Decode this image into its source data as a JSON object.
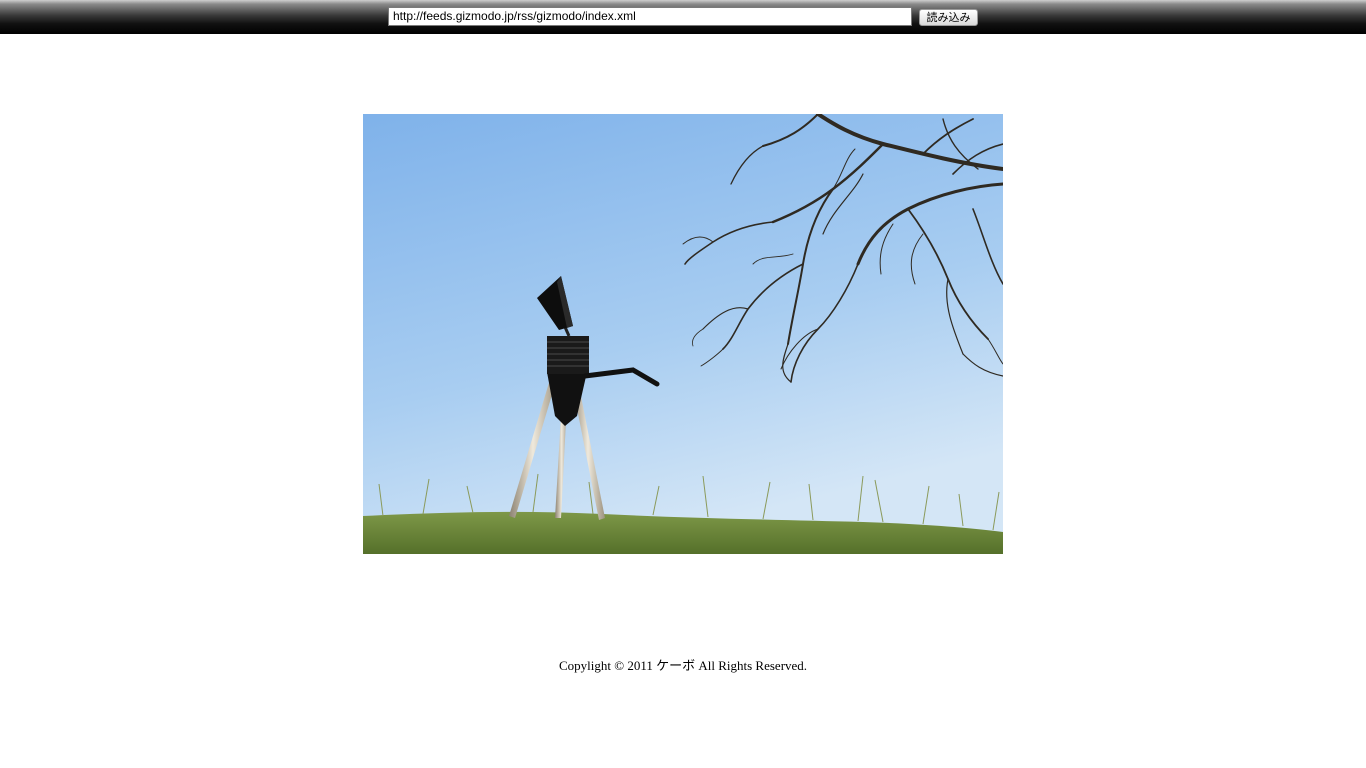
{
  "toolbar": {
    "url_value": "http://feeds.gizmodo.jp/rss/gizmodo/index.xml",
    "load_label": "読み込み"
  },
  "feed_image": {
    "icon": "robot-on-hill-photo",
    "colors": {
      "sky_top": "#86b8ec",
      "sky_bottom": "#cfe3f5",
      "grass": "#6f8a3a",
      "figure": "#111111"
    }
  },
  "footer": {
    "copyright": "Copylight © 2011 ケーボ All Rights Reserved."
  }
}
